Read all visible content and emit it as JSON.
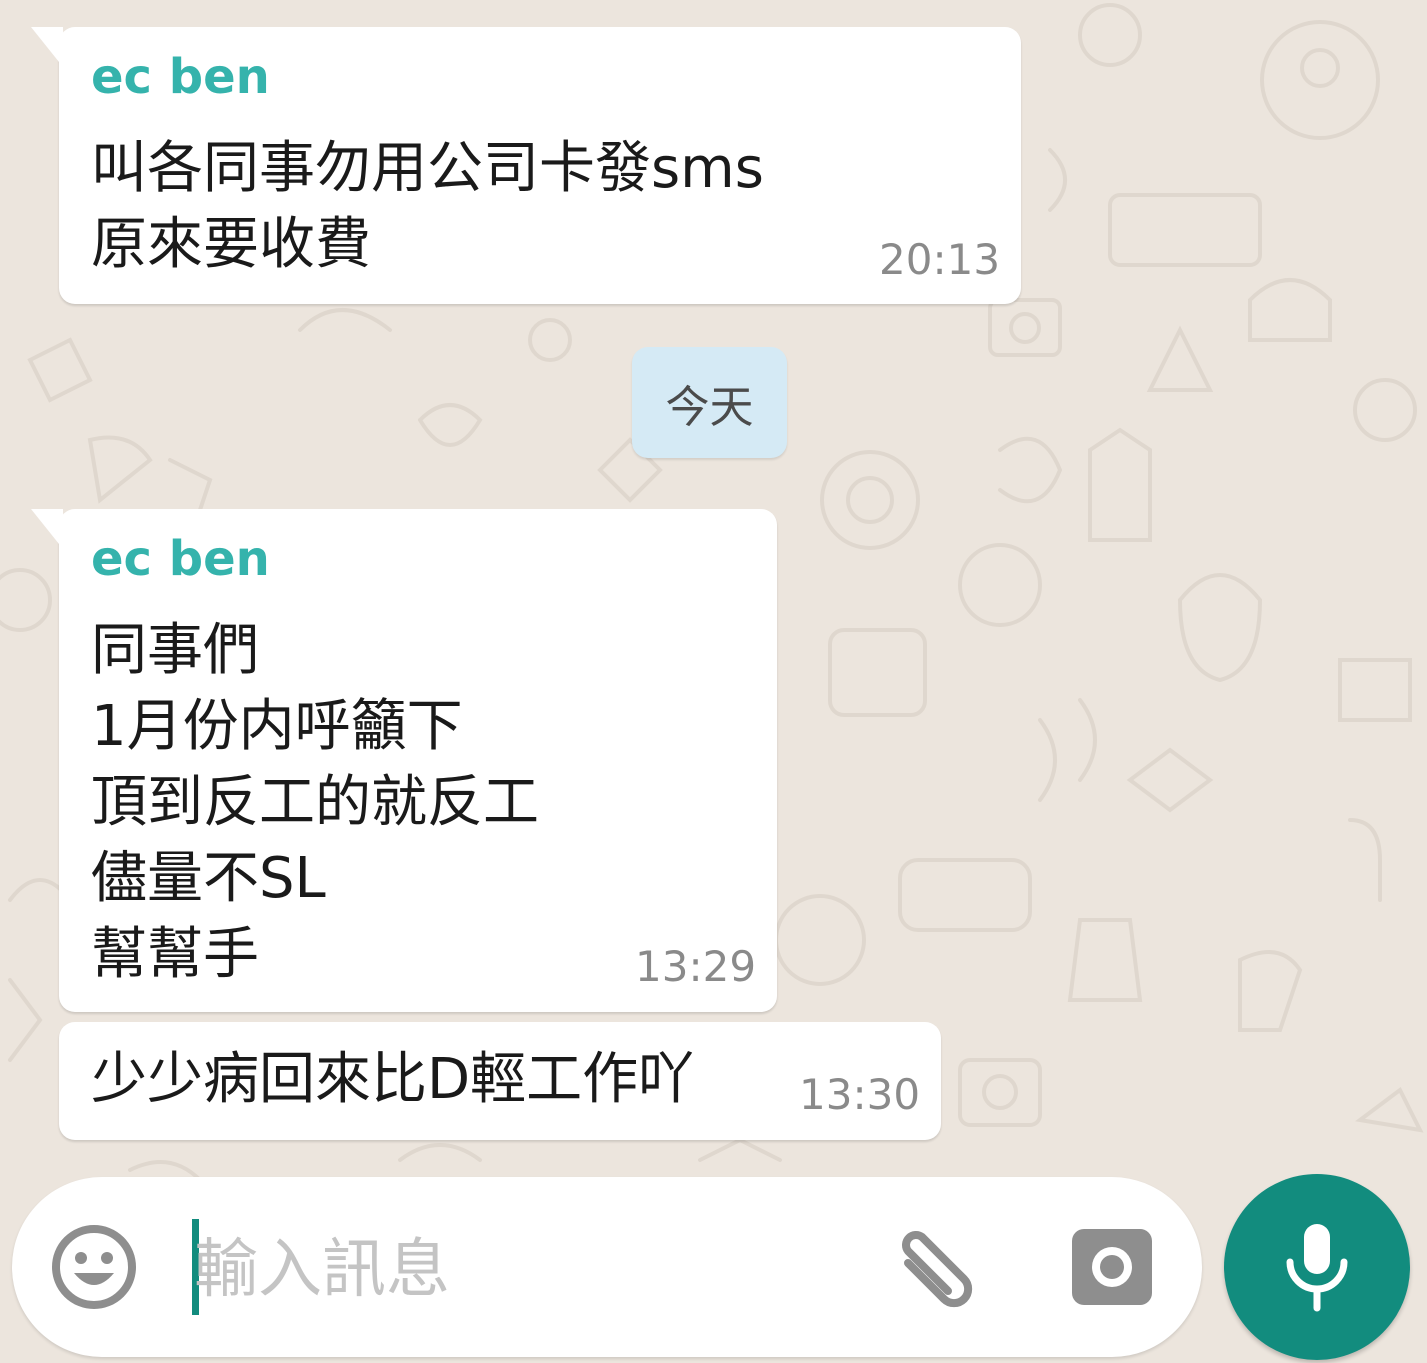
{
  "theme": {
    "wallpaper": "#ece5dd",
    "bubble_incoming": "#ffffff",
    "sender_color": "#35b3ac",
    "date_pill": "#d5eaf5",
    "accent": "#128c7e"
  },
  "chat": {
    "messages": [
      {
        "sender": "ec ben",
        "text": "叫各同事勿用公司卡發sms\n原來要收費",
        "time": "20:13"
      },
      {
        "sender": "ec ben",
        "text": "同事們\n1月份内呼籲下\n頂到反工的就反工\n儘量不SL\n幫幫手",
        "time": "13:29"
      },
      {
        "sender": "",
        "text": "少少病回來比D輕工作吖",
        "time": "13:30"
      }
    ],
    "date_divider": "今天"
  },
  "composer": {
    "placeholder": "輸入訊息",
    "value": "",
    "emoji_icon": "smiley-icon",
    "attach_icon": "paperclip-icon",
    "camera_icon": "camera-icon",
    "mic_icon": "microphone-icon"
  }
}
